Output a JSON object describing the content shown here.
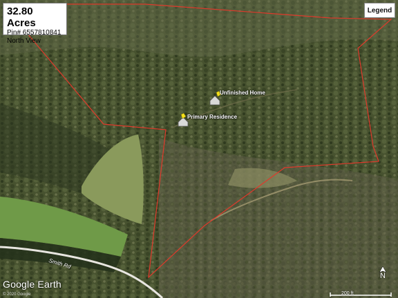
{
  "info": {
    "acres": "32.80 Acres",
    "pin": "Pin# 6557810841",
    "view": "North View"
  },
  "legend_label": "Legend",
  "markers": [
    {
      "label": "Unfinished Home"
    },
    {
      "label": "Primary Residence"
    }
  ],
  "road_label": "Smith Rd",
  "brand": "Google Earth",
  "copyright": "© 2020 Google",
  "scale_label": "200 ft",
  "north_label": "N",
  "colors": {
    "boundary": "#e0392b",
    "marker_pin": "#f5e21a",
    "forest": "#3e4a2a",
    "field": "#86a55a"
  },
  "icons": [
    "house-icon",
    "north-arrow-icon"
  ]
}
